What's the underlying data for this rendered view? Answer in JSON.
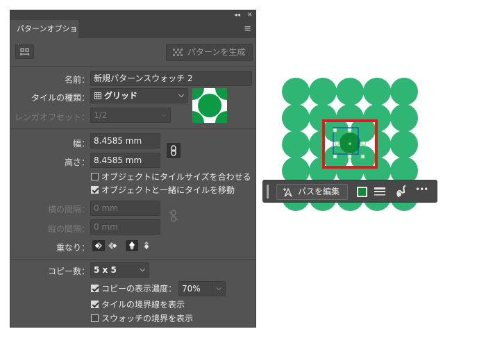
{
  "panel": {
    "title": "パターンオプション",
    "collapse_glyph": "◂◂",
    "close_glyph": "✕",
    "menu_glyph": "≡",
    "generate_button": "パターンを生成",
    "name_label": "名前：",
    "name_value": "新規パターンスウォッチ 2",
    "tile_type_label": "タイルの種類：",
    "tile_type_value": "グリッド",
    "brick_offset_label": "レンガオフセット：",
    "brick_offset_value": "1/2",
    "width_label": "幅：",
    "width_value": "8.4585 mm",
    "height_label": "高さ：",
    "height_value": "8.4585 mm",
    "fit_tile_label": "オブジェクトにタイルサイズを合わせる",
    "move_tile_label": "オブジェクトと一緒にタイルを移動",
    "h_spacing_label": "横の間隔：",
    "h_spacing_value": "0 mm",
    "v_spacing_label": "縦の間隔：",
    "v_spacing_value": "0 mm",
    "overlap_label": "重なり：",
    "copies_label": "コピー数：",
    "copies_value": "5 x 5",
    "dim_copies_label": "コピーの表示濃度：",
    "dim_copies_value": "70%",
    "show_tile_edge_label": "タイルの境界線を表示",
    "show_swatch_bounds_label": "スウォッチの境界を表示",
    "checks": {
      "fit_tile": false,
      "move_tile": true,
      "dim_copies": true,
      "tile_edge": true,
      "swatch_bounds": false
    }
  },
  "context_bar": {
    "edit_path_label": "パスを編集",
    "more_glyph": "•••"
  },
  "colors": {
    "circle": "#2fb574",
    "center": "#0f8a3b",
    "highlight": "#e01a1a",
    "swatch_preview": "#0d9a45"
  }
}
